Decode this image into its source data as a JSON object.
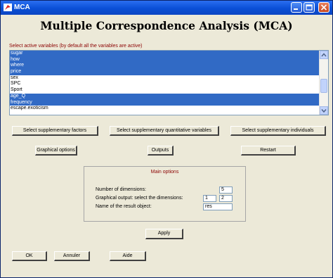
{
  "window": {
    "title": "MCA"
  },
  "heading": "Multiple Correspondence Analysis (MCA)",
  "variables": {
    "caption": "Select active variables (by default all the variables are active)",
    "items": [
      {
        "label": "sugar",
        "selected": true
      },
      {
        "label": "how",
        "selected": true
      },
      {
        "label": "where",
        "selected": true
      },
      {
        "label": "price",
        "selected": true
      },
      {
        "label": "sex",
        "selected": false
      },
      {
        "label": "SPC",
        "selected": false
      },
      {
        "label": "Sport",
        "selected": false
      },
      {
        "label": "age_Q",
        "selected": true
      },
      {
        "label": "frequency",
        "selected": true
      },
      {
        "label": "escape.exoticism",
        "selected": false
      }
    ]
  },
  "buttons": {
    "supp_factors": "Select supplementary factors",
    "supp_quant": "Select supplementary quantitative variables",
    "supp_individuals": "Select supplementary individuals",
    "graphical": "Graphical options",
    "outputs": "Outputs",
    "restart": "Restart",
    "apply": "Apply",
    "ok": "OK",
    "annuler": "Annuler",
    "aide": "Aide"
  },
  "main_options": {
    "title": "Main options",
    "dims_label": "Number of dimensions:",
    "dims_value": "5",
    "graph_label": "Graphical output: select the dimensions:",
    "graph_dim1": "1",
    "graph_dim2": "2",
    "name_label": "Name of the result object:",
    "name_value": "res"
  },
  "colors": {
    "selection": "#316ac5",
    "accent_text": "#8b0000",
    "titlebar": "#0a4fd6"
  }
}
